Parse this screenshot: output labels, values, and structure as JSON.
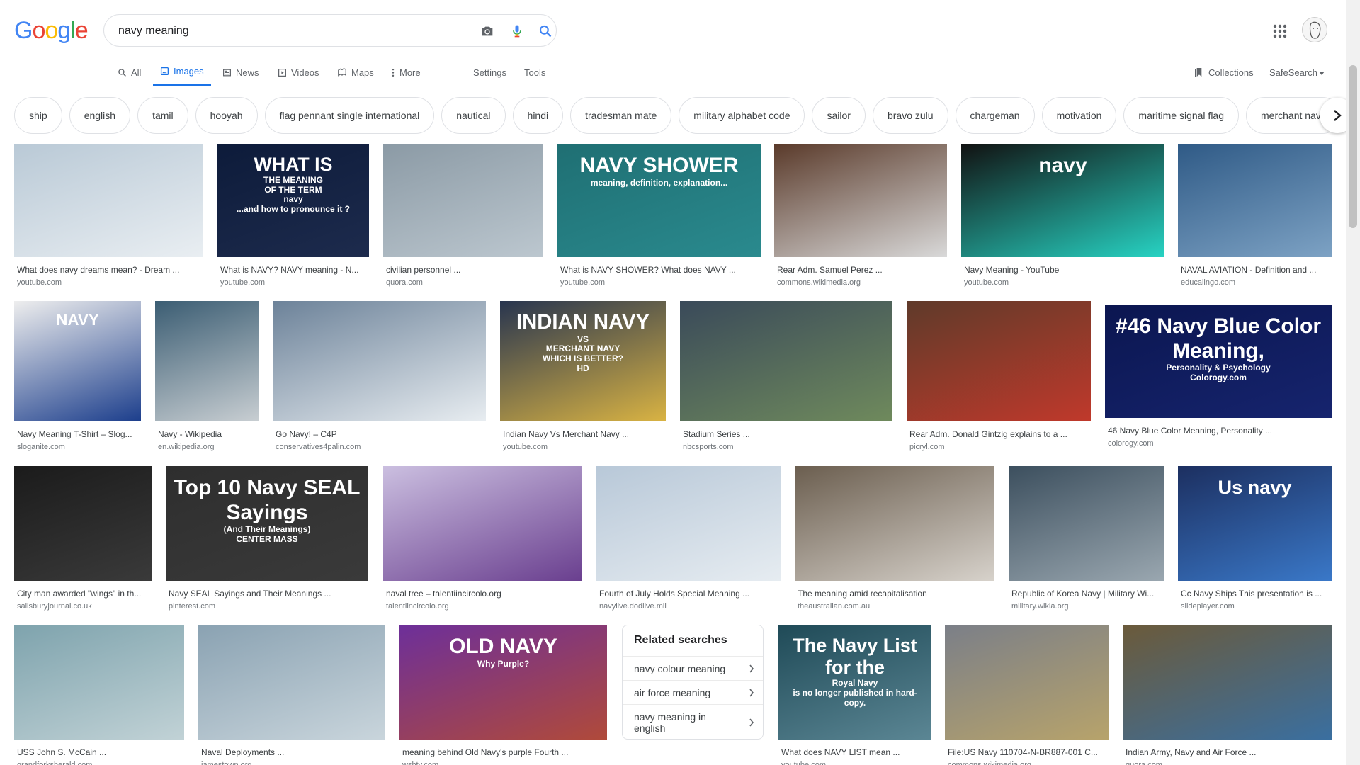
{
  "logo": {
    "text": "Google",
    "letters": [
      {
        "ch": "G",
        "color": "#4285F4"
      },
      {
        "ch": "o",
        "color": "#EA4335"
      },
      {
        "ch": "o",
        "color": "#FBBC05"
      },
      {
        "ch": "g",
        "color": "#4285F4"
      },
      {
        "ch": "l",
        "color": "#34A853"
      },
      {
        "ch": "e",
        "color": "#EA4335"
      }
    ]
  },
  "search": {
    "value": "navy meaning",
    "icons": [
      "camera-icon",
      "microphone-icon",
      "search-icon"
    ]
  },
  "header": {
    "apps_icon": "apps-grid-icon",
    "avatar_icon": "avatar"
  },
  "nav": {
    "tabs": [
      {
        "label": "All",
        "icon": "search-icon",
        "active": false
      },
      {
        "label": "Images",
        "icon": "image-icon",
        "active": true
      },
      {
        "label": "News",
        "icon": "news-icon",
        "active": false
      },
      {
        "label": "Videos",
        "icon": "video-icon",
        "active": false
      },
      {
        "label": "Maps",
        "icon": "map-icon",
        "active": false
      },
      {
        "label": "More",
        "icon": "more-vertical-icon",
        "active": false
      }
    ],
    "settings": "Settings",
    "tools": "Tools",
    "collections": "Collections",
    "safesearch": "SafeSearch"
  },
  "chips": [
    "ship",
    "english",
    "tamil",
    "hooyah",
    "flag pennant single international",
    "nautical",
    "hindi",
    "tradesman mate",
    "military alphabet code",
    "sailor",
    "bravo zulu",
    "chargeman",
    "motivation",
    "maritime signal flag",
    "merchant navy"
  ],
  "results": [
    {
      "caption": "What does navy dreams mean? - Dream ...",
      "source": "youtube.com"
    },
    {
      "caption": "What is NAVY? NAVY meaning - N...",
      "source": "youtube.com",
      "thumb_text": [
        "WHAT IS",
        "THE MEANING",
        "OF THE TERM",
        "navy",
        "...and how to pronounce it ?"
      ]
    },
    {
      "caption": "civilian personnel ...",
      "source": "quora.com"
    },
    {
      "caption": "What is NAVY SHOWER? What does NAVY ...",
      "source": "youtube.com",
      "thumb_text": [
        "NAVY SHOWER",
        "meaning, definition, explanation..."
      ]
    },
    {
      "caption": "Rear Adm. Samuel Perez ...",
      "source": "commons.wikimedia.org"
    },
    {
      "caption": "Navy Meaning - YouTube",
      "source": "youtube.com",
      "thumb_text": [
        "navy"
      ]
    },
    {
      "caption": "NAVAL AVIATION - Definition and ...",
      "source": "educalingo.com"
    },
    {
      "caption": "Navy Meaning T-Shirt – Slog...",
      "source": "sloganite.com",
      "thumb_text": [
        "NAVY"
      ]
    },
    {
      "caption": "Navy - Wikipedia",
      "source": "en.wikipedia.org"
    },
    {
      "caption": "Go Navy! – C4P",
      "source": "conservatives4palin.com"
    },
    {
      "caption": "Indian Navy Vs Merchant Navy ...",
      "source": "youtube.com",
      "thumb_text": [
        "INDIAN NAVY",
        "VS",
        "MERCHANT NAVY",
        "WHICH IS BETTER?",
        "HD"
      ]
    },
    {
      "caption": "Stadium Series ...",
      "source": "nbcsports.com"
    },
    {
      "caption": "Rear Adm. Donald Gintzig explains to a ...",
      "source": "picryl.com"
    },
    {
      "caption": "46 Navy Blue Color Meaning, Personality ...",
      "source": "colorogy.com",
      "thumb_text": [
        "#46 Navy Blue Color Meaning,",
        "Personality & Psychology",
        "Colorogy.com"
      ]
    },
    {
      "caption": "City man awarded \"wings\" in th...",
      "source": "salisburyjournal.co.uk"
    },
    {
      "caption": "Navy SEAL Sayings and Their Meanings ...",
      "source": "pinterest.com",
      "thumb_text": [
        "Top 10 Navy SEAL Sayings",
        "(And Their Meanings)",
        "CENTER MASS"
      ]
    },
    {
      "caption": "naval tree – talentiincircolo.org",
      "source": "talentiincircolo.org"
    },
    {
      "caption": "Fourth of July Holds Special Meaning ...",
      "source": "navylive.dodlive.mil"
    },
    {
      "caption": "The meaning amid recapitalisation",
      "source": "theaustralian.com.au"
    },
    {
      "caption": "Republic of Korea Navy | Military Wi...",
      "source": "military.wikia.org"
    },
    {
      "caption": "Cc Navy Ships This presentation is ...",
      "source": "slideplayer.com",
      "thumb_text": [
        "Us navy"
      ]
    },
    {
      "caption": "USS John S. McCain ...",
      "source": "grandforksherald.com"
    },
    {
      "caption": "Naval Deployments ...",
      "source": "jamestown.org"
    },
    {
      "caption": "meaning behind Old Navy's purple Fourth ...",
      "source": "wsbtv.com",
      "thumb_text": [
        "OLD NAVY",
        "Why Purple?"
      ]
    },
    {
      "caption": "What does NAVY LIST mean ...",
      "source": "youtube.com",
      "thumb_text": [
        "The Navy List for the",
        "Royal Navy",
        "is no longer published in hard-copy."
      ]
    },
    {
      "caption": "File:US Navy 110704-N-BR887-001 C...",
      "source": "commons.wikimedia.org"
    },
    {
      "caption": "Indian Army, Navy and Air Force ...",
      "source": "quora.com"
    }
  ],
  "related": {
    "title": "Related searches",
    "items": [
      "navy colour meaning",
      "air force meaning",
      "navy meaning in english"
    ]
  },
  "colors": {
    "accent": "#1a73e8",
    "text": "#202124",
    "muted": "#70757a",
    "border": "#dfe1e5"
  }
}
